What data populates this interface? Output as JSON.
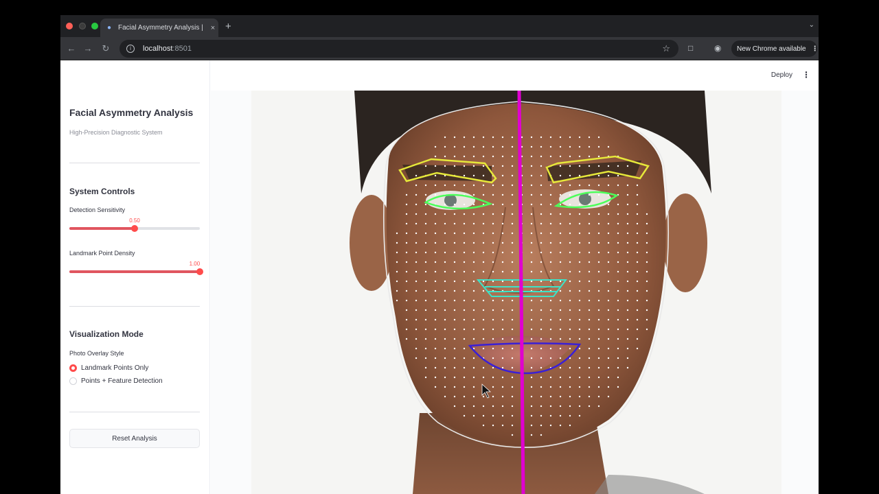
{
  "browser": {
    "tab_title": "Facial Asymmetry Analysis | ",
    "tab_close": "×",
    "new_tab": "+",
    "url_host": "localhost",
    "url_port": ":8501",
    "new_chrome": "New Chrome available"
  },
  "header": {
    "deploy_label": "Deploy"
  },
  "sidebar": {
    "title": "Facial Asymmetry Analysis",
    "subtitle": "High-Precision Diagnostic System",
    "controls_heading": "System Controls",
    "sliders": [
      {
        "label": "Detection Sensitivity",
        "value": 0.5,
        "display": "0.50",
        "min": 0,
        "max": 1
      },
      {
        "label": "Landmark Point Density",
        "value": 1.0,
        "display": "1.00",
        "min": 0,
        "max": 1
      }
    ],
    "viz_heading": "Visualization Mode",
    "overlay_label": "Photo Overlay Style",
    "radio_options": [
      {
        "label": "Landmark Points Only",
        "selected": true
      },
      {
        "label": "Points + Feature Detection",
        "selected": false
      }
    ],
    "reset_label": "Reset Analysis"
  },
  "colors": {
    "accent": "#ff4b4b",
    "midline": "#e000d0",
    "eyebrow": "#e6e83a",
    "eye": "#4cff5a",
    "nose": "#3de3c8",
    "mouth": "#3a1fd6",
    "landmark": "#ffffff"
  },
  "icons": {
    "favicon": "person-icon",
    "back": "arrow-left-icon",
    "forward": "arrow-right-icon",
    "reload": "reload-icon",
    "site_info": "info-icon",
    "bookmark": "star-icon",
    "extensions": "puzzle-icon",
    "profile": "profile-icon",
    "menu": "kebab-icon"
  }
}
